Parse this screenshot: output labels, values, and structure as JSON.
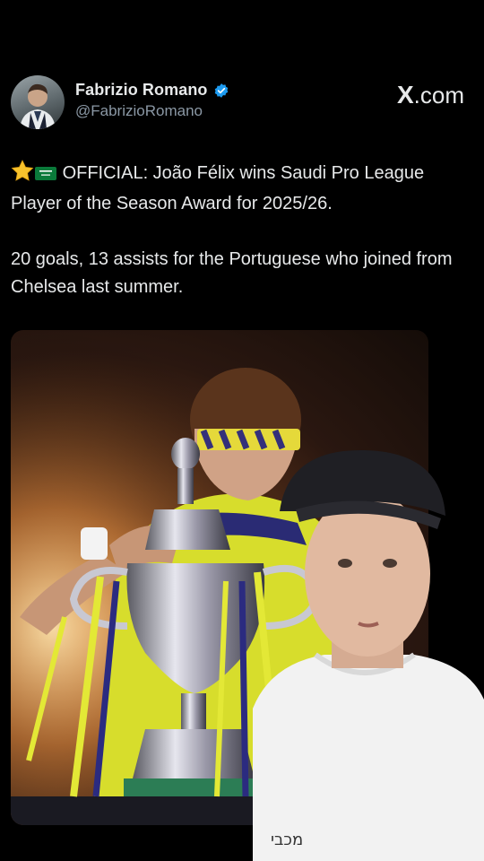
{
  "tweet": {
    "author_name": "Fabrizio Romano",
    "author_handle": "@FabrizioRomano",
    "verified_icon": "verified-badge-icon",
    "site_label_x": "X",
    "site_label_rest": ".com",
    "text_line1": "OFFICIAL: João Félix wins Saudi Pro League Player of the Season Award for 2025/26.",
    "text_line2": "20 goals, 13 assists for the Portuguese who joined from Chelsea last summer.",
    "emojis": [
      "star-emoji",
      "saudi-flag-emoji"
    ],
    "media": {
      "description_icon": "trophy-photo"
    }
  },
  "overlay": {
    "facecam_shirt_text": "מכבי"
  },
  "colors": {
    "background": "#000000",
    "text": "#e7e9ea",
    "handle": "#8b98a5",
    "verified": "#1d9bf0",
    "jersey": "#e3e836"
  }
}
